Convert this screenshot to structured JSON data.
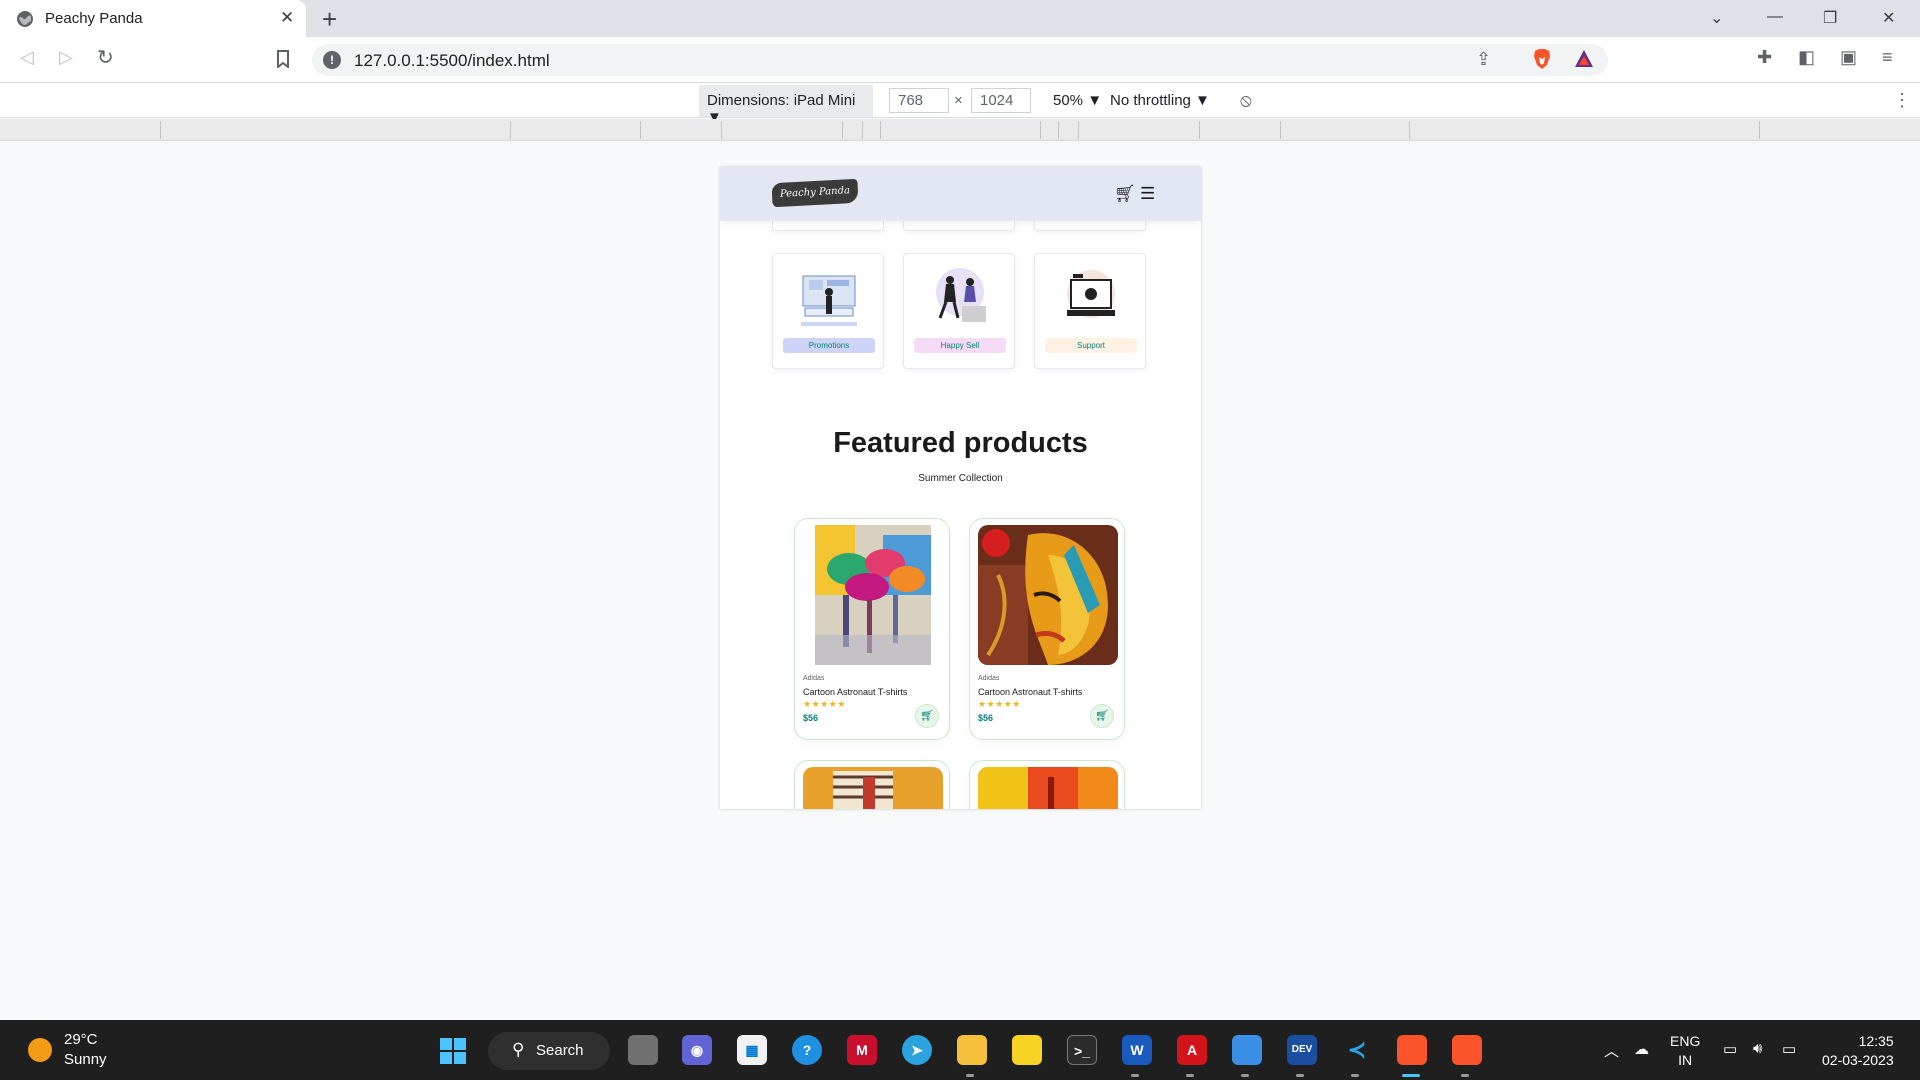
{
  "browser": {
    "tab_title": "Peachy Panda",
    "url": "127.0.0.1:5500/index.html"
  },
  "devtools": {
    "device": "Dimensions: iPad Mini ▼",
    "width_value": "768",
    "times": "×",
    "height_value": "1024",
    "zoom": "50% ▼",
    "throttling": "No throttling ▼"
  },
  "site": {
    "logo_text": "Peachy Panda",
    "features": [
      {
        "label": "Promotions",
        "color": "#cdd4f8"
      },
      {
        "label": "Happy Sell",
        "color": "#f6dbf6"
      },
      {
        "label": "Support",
        "color": "#fff2e5"
      }
    ],
    "featured_title": "Featured products",
    "featured_subtitle": "Summer Collection",
    "products": [
      {
        "brand": "Adidas",
        "name": "Cartoon Astronaut T-shirts",
        "rating": 5,
        "stars": "★★★★★",
        "price": "$56",
        "cart_icon": "cart-icon"
      },
      {
        "brand": "Adidas",
        "name": "Cartoon Astronaut T-shirts",
        "rating": 5,
        "stars": "★★★★★",
        "price": "$56",
        "cart_icon": "cart-icon"
      }
    ]
  },
  "taskbar": {
    "temperature": "29°C",
    "condition": "Sunny",
    "search_label": "Search",
    "lang_top": "ENG",
    "lang_bottom": "IN",
    "time": "12:35",
    "date": "02-03-2023"
  },
  "colors": {
    "accent_teal": "#088178",
    "header_bg": "#e3e6f3",
    "star": "#f3b519",
    "taskbar_bg": "#1f1f1f"
  }
}
